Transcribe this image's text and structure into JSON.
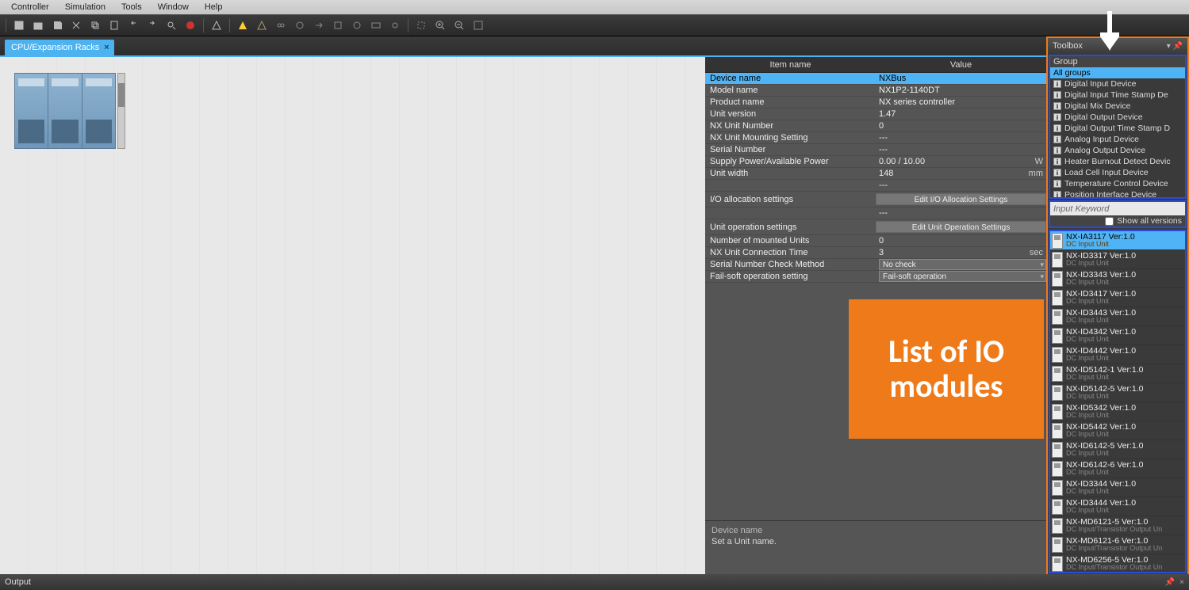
{
  "menu": {
    "items": [
      "Controller",
      "Simulation",
      "Tools",
      "Window",
      "Help"
    ]
  },
  "doc_tab": {
    "title": "CPU/Expansion Racks"
  },
  "prop_header": {
    "name": "Item name",
    "value": "Value"
  },
  "props": [
    {
      "name": "Device name",
      "value": "NXBus",
      "selected": true
    },
    {
      "name": "Model name",
      "value": "NX1P2-1140DT"
    },
    {
      "name": "Product name",
      "value": "NX series controller"
    },
    {
      "name": "Unit version",
      "value": "1.47"
    },
    {
      "name": "NX Unit Number",
      "value": "0"
    },
    {
      "name": "NX Unit Mounting Setting",
      "value": "---"
    },
    {
      "name": "Serial Number",
      "value": "---"
    },
    {
      "name": "Supply Power/Available Power",
      "value": "0.00 / 10.00",
      "unit": "W"
    },
    {
      "name": "Unit width",
      "value": "148",
      "unit": "mm"
    },
    {
      "name": "",
      "value": "---"
    },
    {
      "name": "I/O allocation settings",
      "value": "",
      "button": "Edit I/O Allocation Settings"
    },
    {
      "name": "",
      "value": "---"
    },
    {
      "name": "Unit operation settings",
      "value": "",
      "button": "Edit Unit Operation Settings"
    },
    {
      "name": "Number of mounted Units",
      "value": "0"
    },
    {
      "name": "NX Unit Connection Time",
      "value": "3",
      "unit": "sec"
    },
    {
      "name": "Serial Number Check Method",
      "value": "No check",
      "select": true
    },
    {
      "name": "Fail-soft operation setting",
      "value": "Fail-soft operation",
      "select": true
    }
  ],
  "prop_desc": {
    "title": "Device name",
    "text": "Set a Unit name."
  },
  "toolbox": {
    "title": "Toolbox",
    "group_label": "Group",
    "groups": [
      {
        "label": "All groups",
        "selected": true
      },
      {
        "label": "Digital Input Device"
      },
      {
        "label": "Digital Input Time Stamp De"
      },
      {
        "label": "Digital Mix Device"
      },
      {
        "label": "Digital Output Device"
      },
      {
        "label": "Digital Output Time Stamp D"
      },
      {
        "label": "Analog Input Device"
      },
      {
        "label": "Analog Output Device"
      },
      {
        "label": "Heater Burnout Detect Devic"
      },
      {
        "label": "Load Cell Input Device"
      },
      {
        "label": "Temperature Control Device"
      },
      {
        "label": "Position Interface Device"
      }
    ],
    "keyword_placeholder": "Input Keyword",
    "show_all_label": "Show all versions",
    "modules": [
      {
        "name": "NX-IA3117 Ver:1.0",
        "sub": "DC Input Unit",
        "selected": true
      },
      {
        "name": "NX-ID3317 Ver:1.0",
        "sub": "DC Input Unit"
      },
      {
        "name": "NX-ID3343 Ver:1.0",
        "sub": "DC Input Unit"
      },
      {
        "name": "NX-ID3417 Ver:1.0",
        "sub": "DC Input Unit"
      },
      {
        "name": "NX-ID3443 Ver:1.0",
        "sub": "DC Input Unit"
      },
      {
        "name": "NX-ID4342 Ver:1.0",
        "sub": "DC Input Unit"
      },
      {
        "name": "NX-ID4442 Ver:1.0",
        "sub": "DC Input Unit"
      },
      {
        "name": "NX-ID5142-1 Ver:1.0",
        "sub": "DC Input Unit"
      },
      {
        "name": "NX-ID5142-5 Ver:1.0",
        "sub": "DC Input Unit"
      },
      {
        "name": "NX-ID5342 Ver:1.0",
        "sub": "DC Input Unit"
      },
      {
        "name": "NX-ID5442 Ver:1.0",
        "sub": "DC Input Unit"
      },
      {
        "name": "NX-ID6142-5 Ver:1.0",
        "sub": "DC Input Unit"
      },
      {
        "name": "NX-ID6142-6 Ver:1.0",
        "sub": "DC Input Unit"
      },
      {
        "name": "NX-ID3344 Ver:1.0",
        "sub": "DC Input Unit"
      },
      {
        "name": "NX-ID3444 Ver:1.0",
        "sub": "DC Input Unit"
      },
      {
        "name": "NX-MD6121-5 Ver:1.0",
        "sub": "DC Input/Transistor Output Un"
      },
      {
        "name": "NX-MD6121-6 Ver:1.0",
        "sub": "DC Input/Transistor Output Un"
      },
      {
        "name": "NX-MD6256-5 Ver:1.0",
        "sub": "DC Input/Transistor Output Un"
      }
    ]
  },
  "output": {
    "label": "Output"
  },
  "annotation": {
    "text": "List of IO modules"
  }
}
